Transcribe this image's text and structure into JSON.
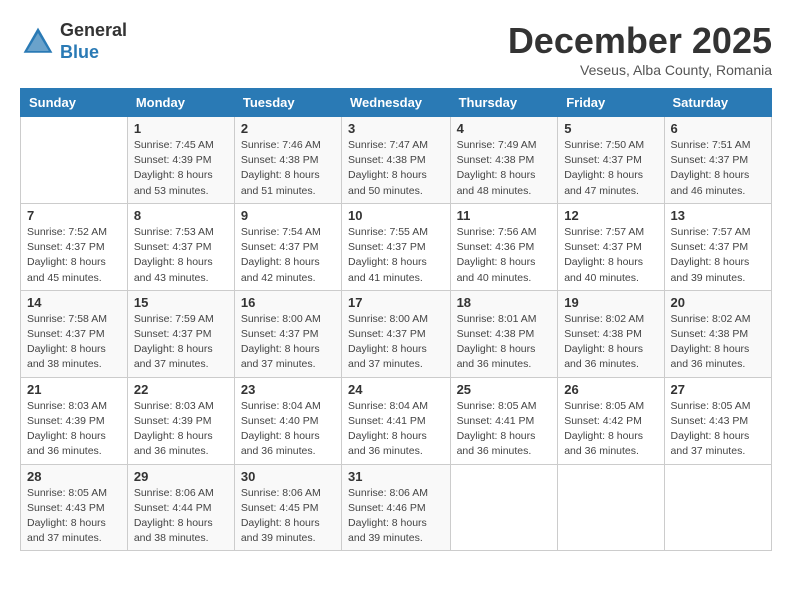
{
  "header": {
    "logo_general": "General",
    "logo_blue": "Blue",
    "month_title": "December 2025",
    "subtitle": "Veseus, Alba County, Romania"
  },
  "days_of_week": [
    "Sunday",
    "Monday",
    "Tuesday",
    "Wednesday",
    "Thursday",
    "Friday",
    "Saturday"
  ],
  "weeks": [
    [
      {
        "day": "",
        "info": ""
      },
      {
        "day": "1",
        "info": "Sunrise: 7:45 AM\nSunset: 4:39 PM\nDaylight: 8 hours\nand 53 minutes."
      },
      {
        "day": "2",
        "info": "Sunrise: 7:46 AM\nSunset: 4:38 PM\nDaylight: 8 hours\nand 51 minutes."
      },
      {
        "day": "3",
        "info": "Sunrise: 7:47 AM\nSunset: 4:38 PM\nDaylight: 8 hours\nand 50 minutes."
      },
      {
        "day": "4",
        "info": "Sunrise: 7:49 AM\nSunset: 4:38 PM\nDaylight: 8 hours\nand 48 minutes."
      },
      {
        "day": "5",
        "info": "Sunrise: 7:50 AM\nSunset: 4:37 PM\nDaylight: 8 hours\nand 47 minutes."
      },
      {
        "day": "6",
        "info": "Sunrise: 7:51 AM\nSunset: 4:37 PM\nDaylight: 8 hours\nand 46 minutes."
      }
    ],
    [
      {
        "day": "7",
        "info": "Sunrise: 7:52 AM\nSunset: 4:37 PM\nDaylight: 8 hours\nand 45 minutes."
      },
      {
        "day": "8",
        "info": "Sunrise: 7:53 AM\nSunset: 4:37 PM\nDaylight: 8 hours\nand 43 minutes."
      },
      {
        "day": "9",
        "info": "Sunrise: 7:54 AM\nSunset: 4:37 PM\nDaylight: 8 hours\nand 42 minutes."
      },
      {
        "day": "10",
        "info": "Sunrise: 7:55 AM\nSunset: 4:37 PM\nDaylight: 8 hours\nand 41 minutes."
      },
      {
        "day": "11",
        "info": "Sunrise: 7:56 AM\nSunset: 4:36 PM\nDaylight: 8 hours\nand 40 minutes."
      },
      {
        "day": "12",
        "info": "Sunrise: 7:57 AM\nSunset: 4:37 PM\nDaylight: 8 hours\nand 40 minutes."
      },
      {
        "day": "13",
        "info": "Sunrise: 7:57 AM\nSunset: 4:37 PM\nDaylight: 8 hours\nand 39 minutes."
      }
    ],
    [
      {
        "day": "14",
        "info": "Sunrise: 7:58 AM\nSunset: 4:37 PM\nDaylight: 8 hours\nand 38 minutes."
      },
      {
        "day": "15",
        "info": "Sunrise: 7:59 AM\nSunset: 4:37 PM\nDaylight: 8 hours\nand 37 minutes."
      },
      {
        "day": "16",
        "info": "Sunrise: 8:00 AM\nSunset: 4:37 PM\nDaylight: 8 hours\nand 37 minutes."
      },
      {
        "day": "17",
        "info": "Sunrise: 8:00 AM\nSunset: 4:37 PM\nDaylight: 8 hours\nand 37 minutes."
      },
      {
        "day": "18",
        "info": "Sunrise: 8:01 AM\nSunset: 4:38 PM\nDaylight: 8 hours\nand 36 minutes."
      },
      {
        "day": "19",
        "info": "Sunrise: 8:02 AM\nSunset: 4:38 PM\nDaylight: 8 hours\nand 36 minutes."
      },
      {
        "day": "20",
        "info": "Sunrise: 8:02 AM\nSunset: 4:38 PM\nDaylight: 8 hours\nand 36 minutes."
      }
    ],
    [
      {
        "day": "21",
        "info": "Sunrise: 8:03 AM\nSunset: 4:39 PM\nDaylight: 8 hours\nand 36 minutes."
      },
      {
        "day": "22",
        "info": "Sunrise: 8:03 AM\nSunset: 4:39 PM\nDaylight: 8 hours\nand 36 minutes."
      },
      {
        "day": "23",
        "info": "Sunrise: 8:04 AM\nSunset: 4:40 PM\nDaylight: 8 hours\nand 36 minutes."
      },
      {
        "day": "24",
        "info": "Sunrise: 8:04 AM\nSunset: 4:41 PM\nDaylight: 8 hours\nand 36 minutes."
      },
      {
        "day": "25",
        "info": "Sunrise: 8:05 AM\nSunset: 4:41 PM\nDaylight: 8 hours\nand 36 minutes."
      },
      {
        "day": "26",
        "info": "Sunrise: 8:05 AM\nSunset: 4:42 PM\nDaylight: 8 hours\nand 36 minutes."
      },
      {
        "day": "27",
        "info": "Sunrise: 8:05 AM\nSunset: 4:43 PM\nDaylight: 8 hours\nand 37 minutes."
      }
    ],
    [
      {
        "day": "28",
        "info": "Sunrise: 8:05 AM\nSunset: 4:43 PM\nDaylight: 8 hours\nand 37 minutes."
      },
      {
        "day": "29",
        "info": "Sunrise: 8:06 AM\nSunset: 4:44 PM\nDaylight: 8 hours\nand 38 minutes."
      },
      {
        "day": "30",
        "info": "Sunrise: 8:06 AM\nSunset: 4:45 PM\nDaylight: 8 hours\nand 39 minutes."
      },
      {
        "day": "31",
        "info": "Sunrise: 8:06 AM\nSunset: 4:46 PM\nDaylight: 8 hours\nand 39 minutes."
      },
      {
        "day": "",
        "info": ""
      },
      {
        "day": "",
        "info": ""
      },
      {
        "day": "",
        "info": ""
      }
    ]
  ]
}
